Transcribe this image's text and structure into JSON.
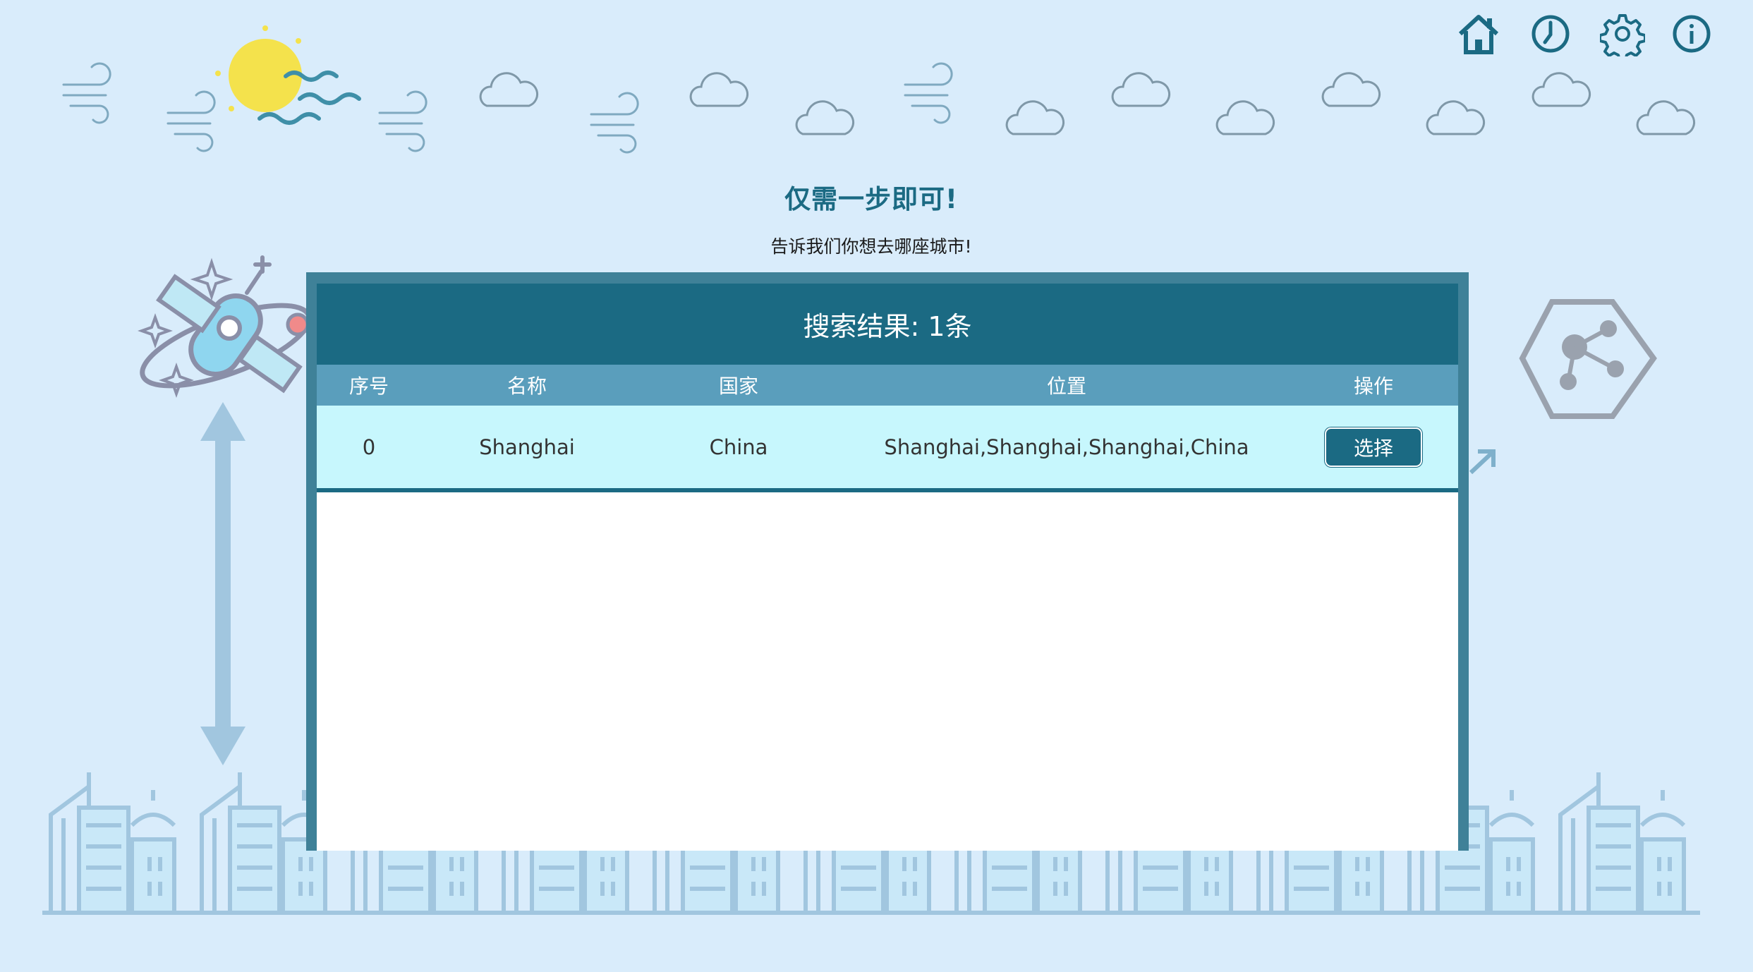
{
  "nav": {
    "home_icon": "home-icon",
    "history_icon": "clock-icon",
    "settings_icon": "gear-icon",
    "about_icon": "info-icon",
    "color": "#1b6a83"
  },
  "heading": {
    "title": "仅需一步即可!",
    "subtitle": "告诉我们你想去哪座城市!"
  },
  "dialog": {
    "header": "搜索结果: 1条",
    "columns": [
      "序号",
      "名称",
      "国家",
      "位置",
      "操作"
    ],
    "rows": [
      {
        "index": "0",
        "name": "Shanghai",
        "country": "China",
        "location": "Shanghai,Shanghai,Shanghai,China",
        "action": "选择"
      }
    ]
  },
  "colors": {
    "background": "#d9ecfb",
    "primary": "#1b6a83",
    "header_row": "#5a9ebc",
    "result_row": "#c7f7fd",
    "sun": "#f4e24c"
  }
}
